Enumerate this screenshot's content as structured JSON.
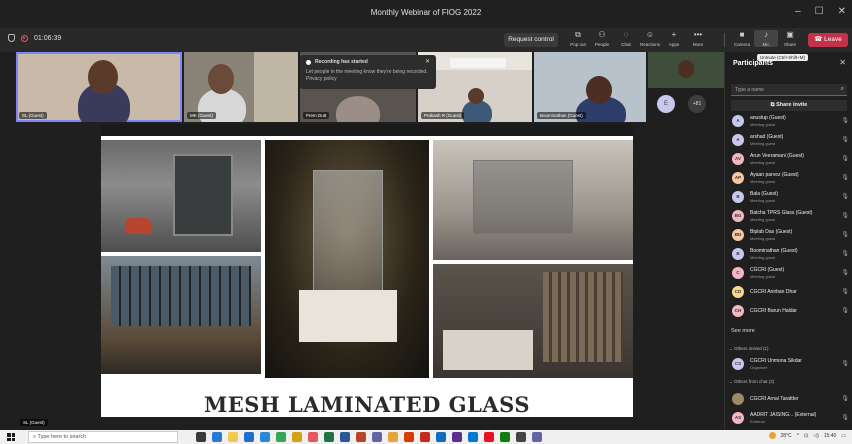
{
  "window": {
    "title": "Monthly Webinar of FIOG 2022"
  },
  "meeting": {
    "timer": "01:06:39",
    "request_control": "Request control",
    "tools": [
      "Pop out",
      "People",
      "Chat",
      "Reactions",
      "Apps",
      "More"
    ],
    "tools2": [
      "Camera",
      "Mic",
      "Share"
    ],
    "leave": "Leave"
  },
  "tiles": [
    {
      "name": "SL (Guest)"
    },
    {
      "name": "MK (Guest)"
    },
    {
      "name": "Prem Dutt"
    },
    {
      "name": "Prakash R (Guest)"
    },
    {
      "name": "Boominathan (Guest)"
    }
  ],
  "recording_notice": {
    "title": "Recording has started",
    "body": "Let people in the meeting know they're being recorded. Privacy policy"
  },
  "overflow": {
    "avatar": "E",
    "count": "+81"
  },
  "slide": {
    "title": "MESH LAMINATED GLASS"
  },
  "sharer": "SL (Guest)",
  "panel": {
    "title": "Participants",
    "tooltip": "Unmute (Ctrl+Shift+M)",
    "search_placeholder": "Type a name",
    "share_invite": "Share invite",
    "participants": [
      {
        "initials": "A",
        "name": "anustup (Guest)",
        "sub": "Meeting guest",
        "color": "#c8c8ee"
      },
      {
        "initials": "A",
        "name": "arshad (Guest)",
        "sub": "Meeting guest",
        "color": "#c8c8ee"
      },
      {
        "initials": "AV",
        "name": "Arun Veeramani (Guest)",
        "sub": "Meeting guest",
        "color": "#f4b6c2"
      },
      {
        "initials": "AP",
        "name": "Ayaan parvez (Guest)",
        "sub": "Meeting guest",
        "color": "#f7c6a3"
      },
      {
        "initials": "B",
        "name": "Bala (Guest)",
        "sub": "Meeting guest",
        "color": "#c8c8ee"
      },
      {
        "initials": "BG",
        "name": "Batcha TPRS Glass (Guest)",
        "sub": "Meeting guest",
        "color": "#f4b6c2"
      },
      {
        "initials": "BD",
        "name": "Biplab Das (Guest)",
        "sub": "Meeting guest",
        "color": "#f7c6a3"
      },
      {
        "initials": "B",
        "name": "Boominathan (Guest)",
        "sub": "Meeting guest",
        "color": "#c8c8ee"
      },
      {
        "initials": "C",
        "name": "CGCRI (Guest)",
        "sub": "Meeting guest",
        "color": "#f4b6c2"
      },
      {
        "initials": "CD",
        "name": "CGCRI Anirban Dhar",
        "sub": "",
        "color": "#f7d98c"
      },
      {
        "initials": "CH",
        "name": "CGCRI Barun Haldar",
        "sub": "",
        "color": "#f4b6c2"
      }
    ],
    "see_more": "See more",
    "others_invited": "Others invited (1)",
    "invited": {
      "initials": "CS",
      "name": "CGCRI Unmona Sikdar",
      "sub": "Organizer",
      "color": "#c8c8ee"
    },
    "others_chat": "Others from chat (2)",
    "chat_people": [
      {
        "initials": "",
        "name": "CGCRI Arnal Tarafder",
        "sub": "",
        "color": "#9a8a6a"
      },
      {
        "initials": "AS",
        "name": "AADRIT JAISING... (External)",
        "sub": "External",
        "color": "#f4b6c2"
      }
    ]
  },
  "taskbar": {
    "search_placeholder": "Type here to search",
    "weather": "28°C",
    "time": "15:40"
  }
}
